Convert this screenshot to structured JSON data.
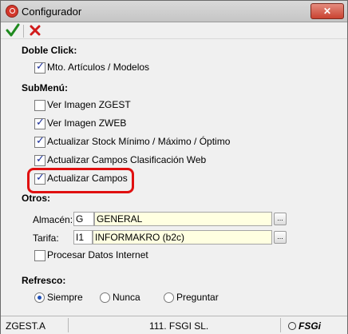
{
  "window": {
    "title": "Configurador",
    "close": "✕"
  },
  "sections": {
    "doble_click": "Doble Click:",
    "submenu": "SubMenú:",
    "otros": "Otros:",
    "refresco": "Refresco:"
  },
  "doble_click": {
    "mto": {
      "label": "Mto. Artículos / Modelos",
      "checked": true
    }
  },
  "submenu": {
    "items": [
      {
        "label": "Ver Imagen ZGEST",
        "checked": false
      },
      {
        "label": "Ver Imagen ZWEB",
        "checked": true
      },
      {
        "label": "Actualizar Stock Mínimo / Máximo / Óptimo",
        "checked": true
      },
      {
        "label": "Actualizar Campos Clasificación Web",
        "checked": true
      },
      {
        "label": "Actualizar Campos",
        "checked": true
      }
    ]
  },
  "otros": {
    "almacen": {
      "label": "Almacén:",
      "code": "G",
      "value": "GENERAL"
    },
    "tarifa": {
      "label": "Tarifa:",
      "code": "I1",
      "value": "INFORMAKRO (b2c)"
    },
    "procesar": {
      "label": "Procesar Datos Internet",
      "checked": false
    },
    "ellipsis": "..."
  },
  "refresco": {
    "options": [
      {
        "label": "Siempre",
        "selected": true
      },
      {
        "label": "Nunca",
        "selected": false
      },
      {
        "label": "Preguntar",
        "selected": false
      }
    ]
  },
  "status": {
    "left": "ZGEST.A",
    "center": "111. FSGI SL.",
    "logo": "FSGi"
  },
  "colors": {
    "highlight": "#e01010",
    "ok": "#1f8a1f",
    "cancel": "#d11a1a",
    "field_bg": "#ffffe1"
  }
}
